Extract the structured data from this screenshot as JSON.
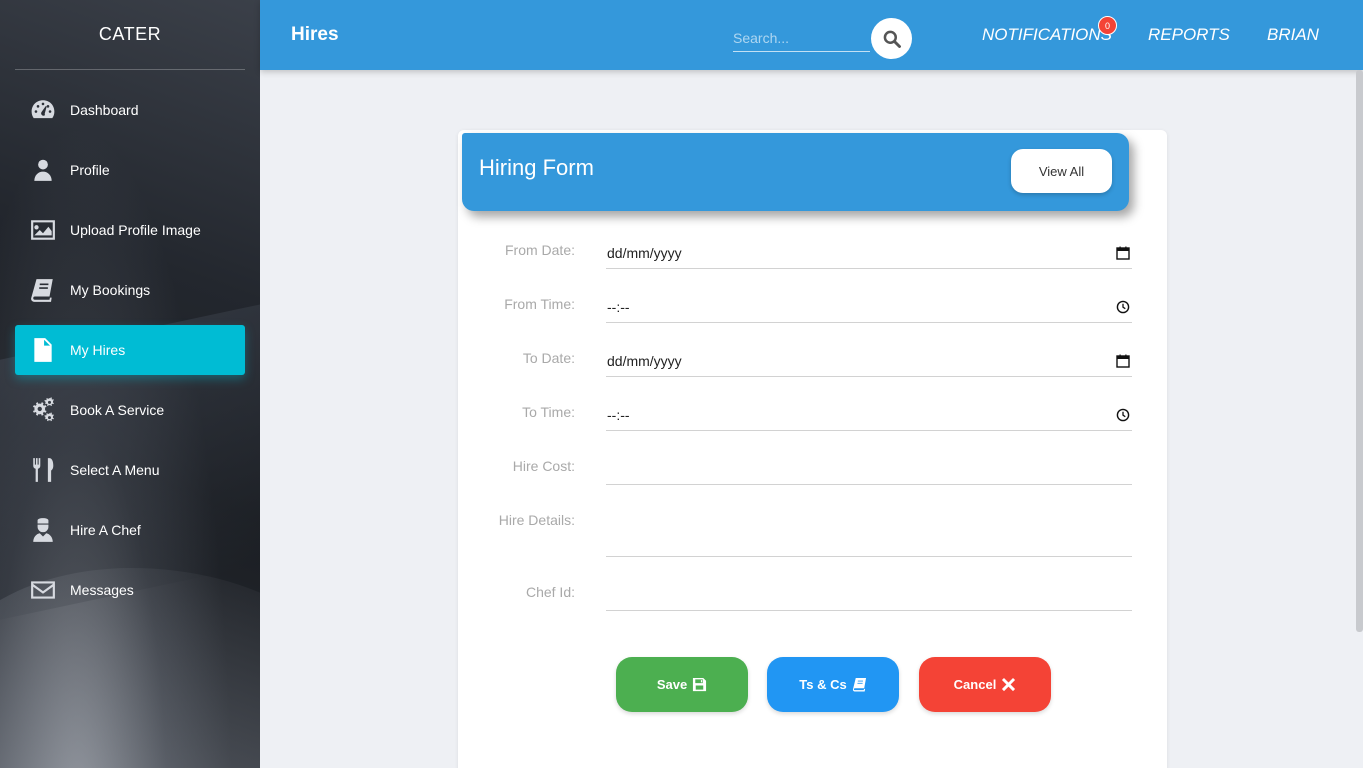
{
  "sidebar": {
    "brand": "CATER",
    "items": [
      {
        "label": "Dashboard",
        "icon": "dashboard-icon"
      },
      {
        "label": "Profile",
        "icon": "user-icon"
      },
      {
        "label": "Upload Profile Image",
        "icon": "image-icon"
      },
      {
        "label": "My Bookings",
        "icon": "book-icon"
      },
      {
        "label": "My Hires",
        "icon": "file-icon",
        "active": true
      },
      {
        "label": "Book A Service",
        "icon": "cogs-icon"
      },
      {
        "label": "Select A Menu",
        "icon": "utensils-icon"
      },
      {
        "label": "Hire A Chef",
        "icon": "chef-icon"
      },
      {
        "label": "Messages",
        "icon": "envelope-icon"
      }
    ],
    "active_color": "#00bcd4"
  },
  "header": {
    "title": "Hires",
    "search_placeholder": "Search...",
    "notifications_label": "NOTIFICATIONS",
    "notifications_count": "0",
    "reports_label": "REPORTS",
    "user_label": "BRIAN",
    "color": "#3498db"
  },
  "form": {
    "title": "Hiring Form",
    "view_all_label": "View All",
    "fields": {
      "from_date": {
        "label": "From Date:",
        "placeholder": "dd/mm/yyyy"
      },
      "from_time": {
        "label": "From Time:",
        "placeholder": "--:--"
      },
      "to_date": {
        "label": "To Date:",
        "placeholder": "dd/mm/yyyy"
      },
      "to_time": {
        "label": "To Time:",
        "placeholder": "--:--"
      },
      "hire_cost": {
        "label": "Hire Cost:",
        "value": ""
      },
      "hire_details": {
        "label": "Hire Details:",
        "value": ""
      },
      "chef_id": {
        "label": "Chef Id:",
        "value": ""
      }
    },
    "buttons": {
      "save": {
        "label": "Save",
        "color": "#4caf50"
      },
      "terms": {
        "label": "Ts & Cs",
        "color": "#2196f3"
      },
      "cancel": {
        "label": "Cancel",
        "color": "#f44336"
      }
    }
  }
}
